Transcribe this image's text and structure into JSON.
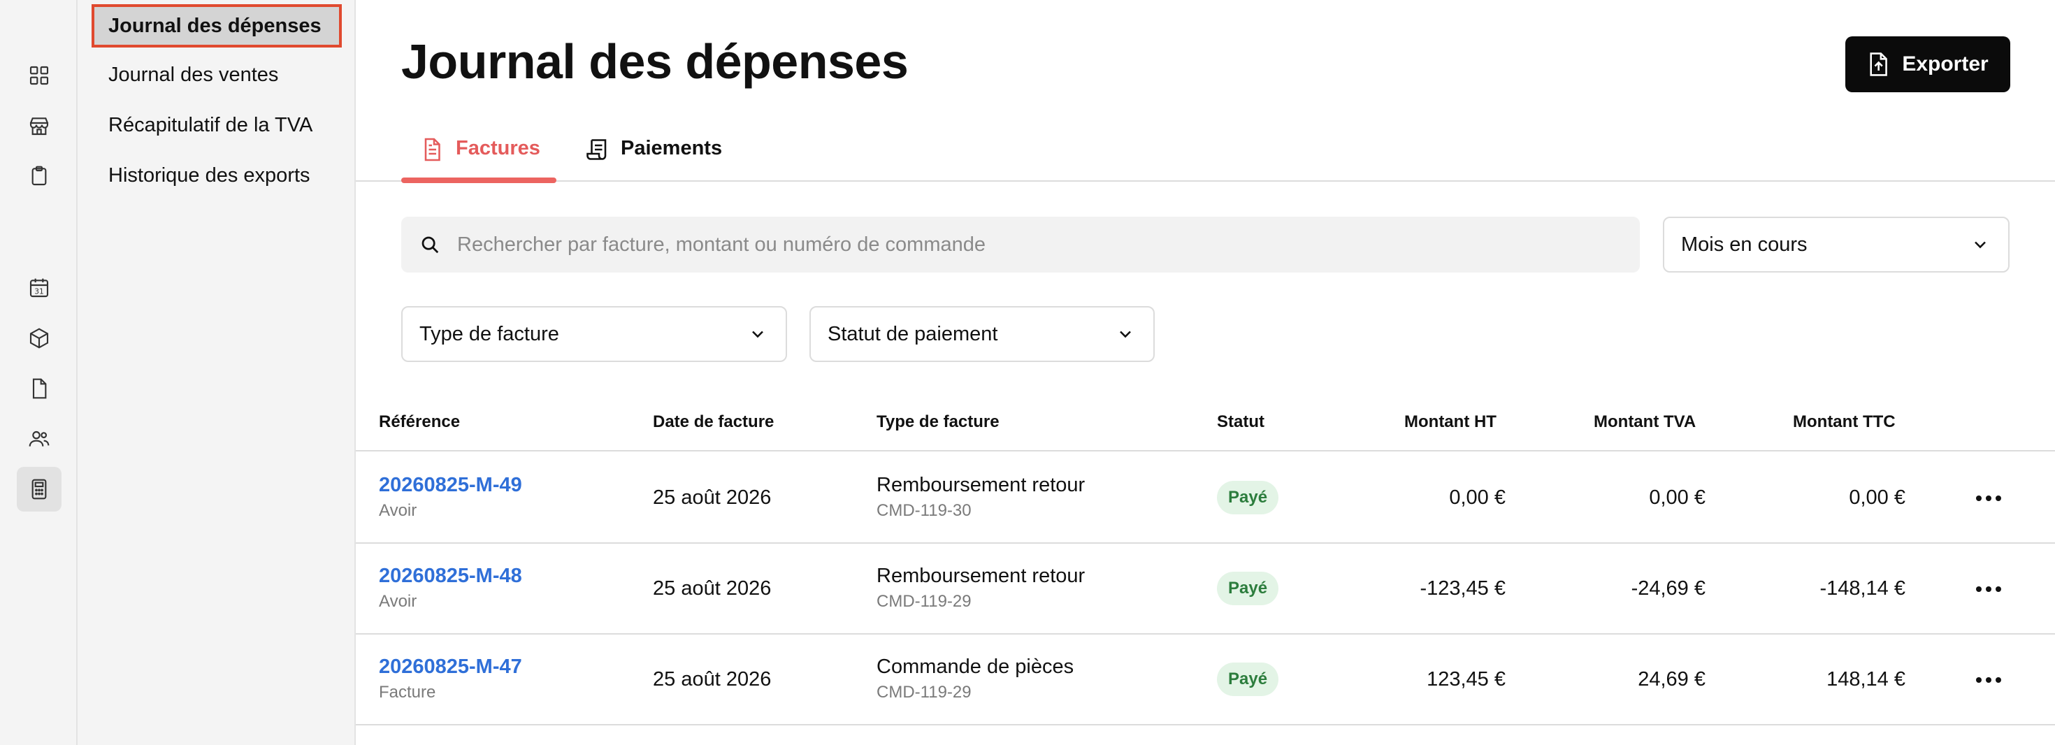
{
  "rail": {
    "icons": [
      {
        "name": "dashboard-grid-icon"
      },
      {
        "name": "store-icon"
      },
      {
        "name": "clipboard-icon"
      },
      {
        "name": "calendar-icon",
        "label": "31"
      },
      {
        "name": "package-box-icon"
      },
      {
        "name": "document-icon"
      },
      {
        "name": "users-icon"
      },
      {
        "name": "calculator-icon",
        "active": true
      }
    ]
  },
  "subnav": {
    "items": [
      {
        "label": "Journal des dépenses",
        "active": true
      },
      {
        "label": "Journal des ventes"
      },
      {
        "label": "Récapitulatif de la TVA"
      },
      {
        "label": "Historique des exports"
      }
    ]
  },
  "header": {
    "title": "Journal des dépenses",
    "export_label": "Exporter"
  },
  "tabs": [
    {
      "label": "Factures",
      "icon": "invoice-icon",
      "active": true
    },
    {
      "label": "Paiements",
      "icon": "receipt-scroll-icon"
    }
  ],
  "search": {
    "placeholder": "Rechercher par facture, montant ou numéro de commande",
    "value": ""
  },
  "filters": {
    "period": "Mois en cours",
    "invoice_type": "Type de facture",
    "payment_status": "Statut de paiement"
  },
  "table": {
    "columns": {
      "reference": "Référence",
      "date": "Date de facture",
      "type": "Type de facture",
      "status": "Statut",
      "ht": "Montant HT",
      "tva": "Montant TVA",
      "ttc": "Montant TTC"
    },
    "rows": [
      {
        "ref": "20260825-M-49",
        "kind": "Avoir",
        "date": "25 août 2026",
        "type": "Remboursement retour",
        "order": "CMD-119-30",
        "status": "Payé",
        "ht": "0,00 €",
        "tva": "0,00 €",
        "ttc": "0,00 €"
      },
      {
        "ref": "20260825-M-48",
        "kind": "Avoir",
        "date": "25 août 2026",
        "type": "Remboursement retour",
        "order": "CMD-119-29",
        "status": "Payé",
        "ht": "-123,45 €",
        "tva": "-24,69 €",
        "ttc": "-148,14 €"
      },
      {
        "ref": "20260825-M-47",
        "kind": "Facture",
        "date": "25 août 2026",
        "type": "Commande de pièces",
        "order": "CMD-119-29",
        "status": "Payé",
        "ht": "123,45 €",
        "tva": "24,69 €",
        "ttc": "148,14 €"
      }
    ]
  },
  "colors": {
    "accent": "#ec6460",
    "link": "#2f6fd8",
    "status_paid_bg": "#e3f4e6",
    "status_paid_text": "#2c7d3d",
    "highlight_border": "#e04a2f"
  }
}
